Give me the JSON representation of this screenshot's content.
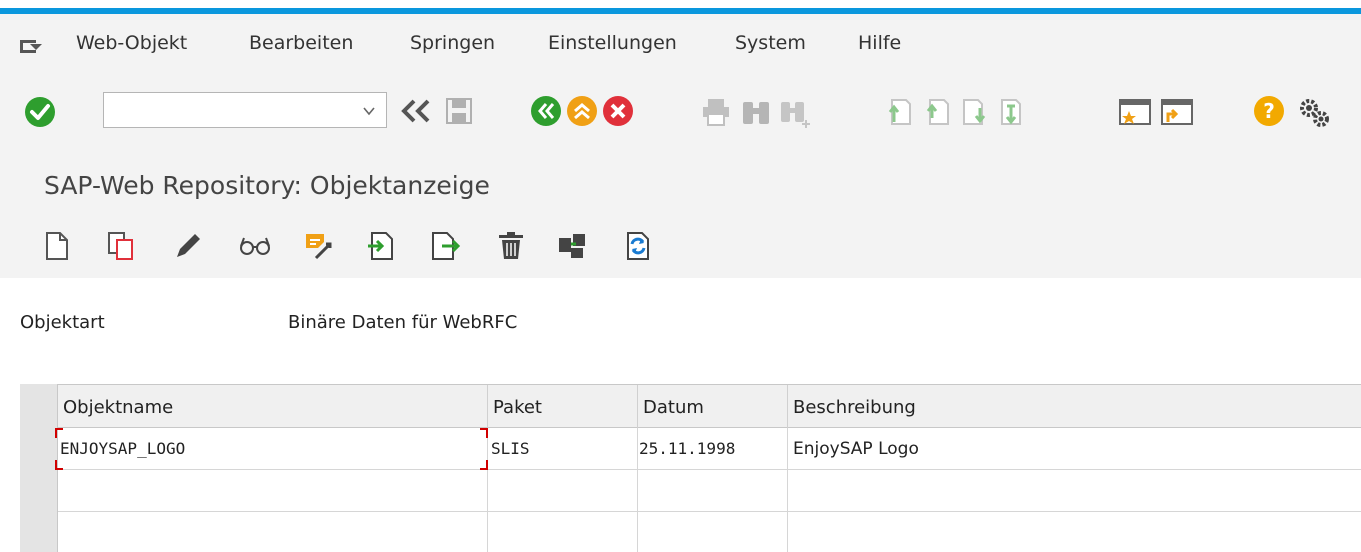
{
  "menu": {
    "items": [
      "Web-Objekt",
      "Bearbeiten",
      "Springen",
      "Einstellungen",
      "System",
      "Hilfe"
    ]
  },
  "toolbar": {
    "command_value": "",
    "icons": [
      "enter-check",
      "back-arrows",
      "save",
      "back",
      "exit",
      "cancel",
      "print",
      "find",
      "find-next",
      "first-page",
      "previous-page",
      "next-page",
      "last-page",
      "create-session",
      "generate-shortcut",
      "help",
      "customize"
    ],
    "colors": {
      "green": "#2e9e2e",
      "orange": "#f0a015",
      "red": "#e0303a",
      "gray": "#9a9a9a",
      "help": "#f2a900"
    }
  },
  "title": "SAP-Web Repository: Objektanzeige",
  "app_toolbar": {
    "icons": [
      "create",
      "copy",
      "change",
      "display",
      "where-used",
      "import",
      "export",
      "delete",
      "assign",
      "transport"
    ]
  },
  "form": {
    "objektart_label": "Objektart",
    "objektart_value": "Binäre Daten für WebRFC"
  },
  "table": {
    "columns": [
      "Objektname",
      "Paket",
      "Datum",
      "Beschreibung"
    ],
    "rows": [
      {
        "objektname": "ENJOYSAP_LOGO",
        "paket": "SLIS",
        "datum": "25.11.1998",
        "beschreibung": "EnjoySAP Logo"
      }
    ]
  }
}
